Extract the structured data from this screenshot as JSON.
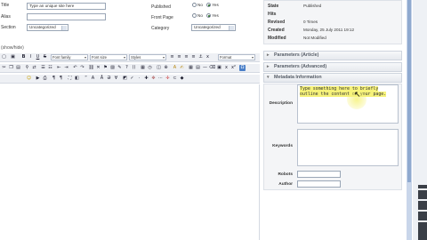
{
  "form": {
    "title_label": "Title",
    "title_value": "Type an unique site here",
    "alias_label": "Alias",
    "section_label": "Section",
    "section_value": "Uncategorized",
    "published_label": "Published",
    "frontpage_label": "Front Page",
    "category_label": "Category",
    "category_value": "Uncategorized",
    "radio_no": "No",
    "radio_yes": "Yes"
  },
  "info": {
    "state_label": "State",
    "state_value": "Published",
    "hits_label": "Hits",
    "revised_label": "Revised",
    "revised_value": "0 Times",
    "created_label": "Created",
    "created_value": "Monday, 25 July 2011 19:12",
    "modified_label": "Modified",
    "modified_value": "Not Modified"
  },
  "editor": {
    "toggle_label": "(show/hide)",
    "font_family": "Font family",
    "font_size": "Font size",
    "styles": "Styles",
    "format": "Format"
  },
  "panels": {
    "article": "Parameters (Article)",
    "advanced": "Parameters (Advanced)",
    "metadata": "Metadata Information"
  },
  "metadata": {
    "description_label": "Description",
    "description_value": "Type something here to briefly outline the content of your page.",
    "keywords_label": "Keywords",
    "robots_label": "Robots",
    "author_label": "Author"
  },
  "colors": {
    "highlight": "#f6f27a",
    "accent_green": "#2a6d2a",
    "scrollbar": "#c9d6ea"
  }
}
